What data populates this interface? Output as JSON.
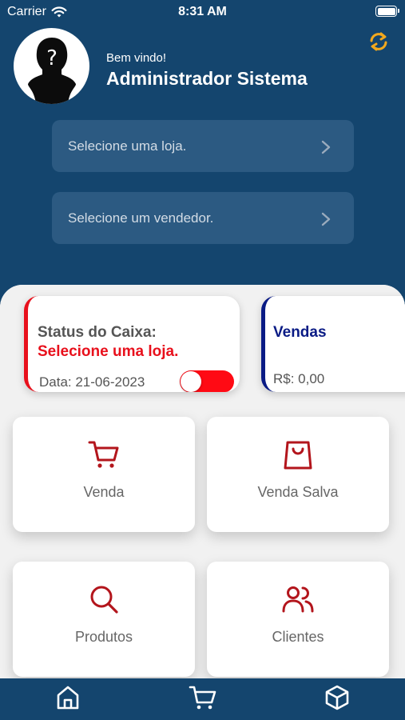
{
  "status_bar": {
    "carrier": "Carrier",
    "time": "8:31 AM"
  },
  "header": {
    "greeting": "Bem vindo!",
    "user_name": "Administrador Sistema",
    "store_placeholder": "Selecione uma loja.",
    "seller_placeholder": "Selecione um vendedor."
  },
  "cash_card": {
    "title": "Status do Caixa:",
    "status": "Selecione uma loja.",
    "date": "Data: 21-06-2023",
    "toggle_on": true
  },
  "sales_card": {
    "title": "Vendas",
    "value": "R$: 0,00"
  },
  "menu": {
    "venda": "Venda",
    "venda_salva": "Venda Salva",
    "produtos": "Produtos",
    "clientes": "Clientes"
  },
  "icons": {
    "refresh": "refresh-icon",
    "cart": "cart-icon",
    "bag": "shopping-bag-icon",
    "search": "search-icon",
    "users": "users-icon",
    "home": "home-icon",
    "box": "box-icon"
  },
  "colors": {
    "primary": "#14456e",
    "accent_red": "#e8101c",
    "accent_blue": "#0a1b85",
    "icon_red": "#b3151c",
    "refresh": "#f2a81d"
  }
}
